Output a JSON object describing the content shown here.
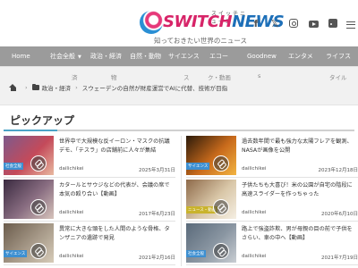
{
  "header": {
    "logo_switch": "SWITCH",
    "logo_news": "NEWS",
    "logo_kana": "スイッチニュース",
    "tagline": "知っておきたい世界のニュース",
    "social": {
      "facebook": "f",
      "x": "𝕏"
    }
  },
  "nav": {
    "items": [
      {
        "label": "Home",
        "caret": ""
      },
      {
        "label": "社会全般",
        "caret": "▼"
      },
      {
        "label": "政治・経済",
        "caret": ""
      },
      {
        "label": "自然・動物",
        "caret": ""
      },
      {
        "label": "サイエンス",
        "caret": ""
      },
      {
        "label": "エコー",
        "caret": ""
      },
      {
        "label": "Goodnew",
        "caret": ""
      },
      {
        "label": "エンタメ",
        "caret": ""
      },
      {
        "label": "ライフス",
        "caret": ""
      }
    ]
  },
  "breadcrumb_ghost": [
    "済",
    "物",
    "ス",
    "ク・動画",
    "s",
    "タイル"
  ],
  "breadcrumb": {
    "separator": "›",
    "category": "政治・経済",
    "current": "スウェーデンの自然が財産運営でAIに代替、技術が目指"
  },
  "pickup": {
    "title": "ピックアップ"
  },
  "articles": [
    {
      "title": "世界中で大規模な反イーロン・マスクの抗議デモ、「テスラ」の店舗前に人々が集結",
      "author": "dailichikei",
      "date": "2025年3月31日",
      "category": "社会全般",
      "category_color": "#3d8fd1",
      "thumb_colors": [
        "#7d5a8c",
        "#c44a5a",
        "#e8b9a0"
      ]
    },
    {
      "title": "過去数年間で最も強力な太陽フレアを観測、NASAが画像を公開",
      "author": "dailichikei",
      "date": "2023年12月18日",
      "category": "サイエンス",
      "category_color": "#3d8fd1",
      "thumb_colors": [
        "#2b1a0a",
        "#c96b1c",
        "#f2b441"
      ]
    },
    {
      "title": "カタールとサウジなどの代表が、会議の席で本気の殴り合い【動画】",
      "author": "dailichikei",
      "date": "2017年6月23日",
      "category": "",
      "category_color": "#3d8fd1",
      "thumb_colors": [
        "#3a2a40",
        "#8a6e82",
        "#d7c4bb"
      ]
    },
    {
      "title": "子供たちも大喜び！米の公園が自宅の階段に高速スライダーを作っちゃった",
      "author": "dailichikei",
      "date": "2020年6月10日",
      "category": "ニュース・動画",
      "category_color": "#c9b32c",
      "thumb_colors": [
        "#8e6a4a",
        "#d9c7a8",
        "#f5efe3"
      ]
    },
    {
      "title": "異常に大きな頭をした人間のような骨格、タンザニアの遺跡で発見",
      "author": "dailichikei",
      "date": "2021年2月16日",
      "category": "サイエンス",
      "category_color": "#3d8fd1",
      "thumb_colors": [
        "#6b5c4c",
        "#a89b8a",
        "#d6cbb8"
      ]
    },
    {
      "title": "路上で強盗詐欺、男が母親の目の前で子供をさらい、車の中へ【動画】",
      "author": "dailichikei",
      "date": "2021年7月19日",
      "category": "社会全般",
      "category_color": "#3d8fd1",
      "thumb_colors": [
        "#5a6a7a",
        "#8a96a2",
        "#c9ced3"
      ]
    }
  ]
}
